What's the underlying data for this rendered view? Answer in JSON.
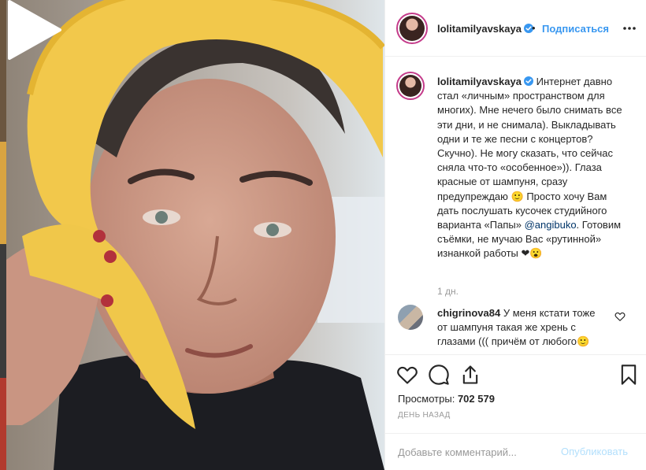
{
  "post": {
    "username": "lolitamilyavskaya",
    "separator": "•",
    "follow_label": "Подписаться",
    "caption_text": "Интернет давно стал «личным» пространством для многих). Мне нечего было снимать все эти дни, и не снимала). Выкладывать одни и те же песни с концертов? Скучно). Не могу сказать, что сейчас сняла что-то «особенное»)). Глаза красные от шампуня, сразу предупреждаю 🙂 Просто хочу Вам дать послушать кусочек студийного варианта «Папы» ",
    "caption_mention": "@angibuko",
    "caption_tail": ". Готовим съёмки, не мучаю Вас «рутинной» изнанкой работы ❤😮",
    "time_ago": "1 дн."
  },
  "comment": {
    "username": "chigrinova84",
    "text": "У меня кстати тоже от шампуня такая же хрень с глазами ((( причём от любого🙂"
  },
  "stats": {
    "views_label": "Просмотры:",
    "views_count": "702 579",
    "date_label": "день назад"
  },
  "composer": {
    "placeholder": "Добавьте комментарий...",
    "publish_label": "Опубликовать"
  },
  "colors": {
    "accent": "#3897f0",
    "publish_disabled": "#b2dffc",
    "text": "#262626",
    "muted": "#999999",
    "towel": "#f2c84b"
  },
  "icons": {
    "play": "play-icon",
    "more": "more-icon",
    "verified": "verified-icon",
    "like": "heart-icon",
    "comment": "comment-icon",
    "share": "share-icon",
    "save": "bookmark-icon"
  }
}
